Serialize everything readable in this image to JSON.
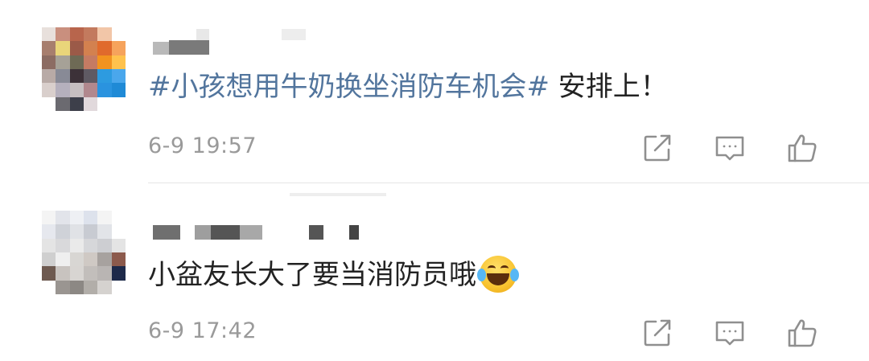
{
  "comments": [
    {
      "avatar_colors": [
        "#e8e0dc",
        "#c98f7e",
        "#b8654c",
        "#c37a5e",
        "#f2c6a8",
        "#ffffff",
        "#a77e6e",
        "#e9d57a",
        "#9b5a48",
        "#d3814f",
        "#e06a2c",
        "#f6a35c",
        "#8c6c63",
        "#a6a197",
        "#6e6a55",
        "#c57b63",
        "#f2931f",
        "#ffc24d",
        "#b8aaa6",
        "#888a96",
        "#3c3138",
        "#5f5a63",
        "#2d9be0",
        "#4aa7ec",
        "#d9cfcc",
        "#b5b0bd",
        "#c7bfc1",
        "#b1888e",
        "#2a93df",
        "#1f8ad6",
        "#ffffff",
        "#6b6a70",
        "#3d3f4a",
        "#e1d9dc",
        "#ffffff",
        "#ffffff"
      ],
      "text_topic": "#小孩想用牛奶换坐消防车机会#",
      "text_rest": " 安排上！",
      "time": "6-9 19:57"
    },
    {
      "avatar_colors": [
        "#f4f4f4",
        "#e2e4ea",
        "#eef0f4",
        "#dde2ec",
        "#f4f4f4",
        "#ffffff",
        "#e6e8ee",
        "#cfd2d8",
        "#e0e2e6",
        "#c8cbd2",
        "#e2e4e8",
        "#ffffff",
        "#e4e4e4",
        "#d9d9db",
        "#eaeaea",
        "#d6d7da",
        "#cdced2",
        "#e4e4e4",
        "#cfcfcf",
        "#efefef",
        "#d8d6d3",
        "#cfc9c4",
        "#a7a29f",
        "#8c5a4c",
        "#6e5a50",
        "#c8c3bf",
        "#d8d5d2",
        "#c2bebb",
        "#b9b5b3",
        "#1e2a4a",
        "#ffffff",
        "#9a9591",
        "#8c8884",
        "#b2aea9",
        "#d5d2cf",
        "#ffffff"
      ],
      "text": "小盆友长大了要当消防员哦",
      "emoji": "laugh-cry-emoji",
      "time": "6-9 17:42"
    }
  ],
  "colors": {
    "topic": "#52759d",
    "text": "#222222",
    "time": "#9a9a9a",
    "icon": "#8f8f8f"
  },
  "icons": [
    "share-icon",
    "comment-icon",
    "like-icon"
  ]
}
